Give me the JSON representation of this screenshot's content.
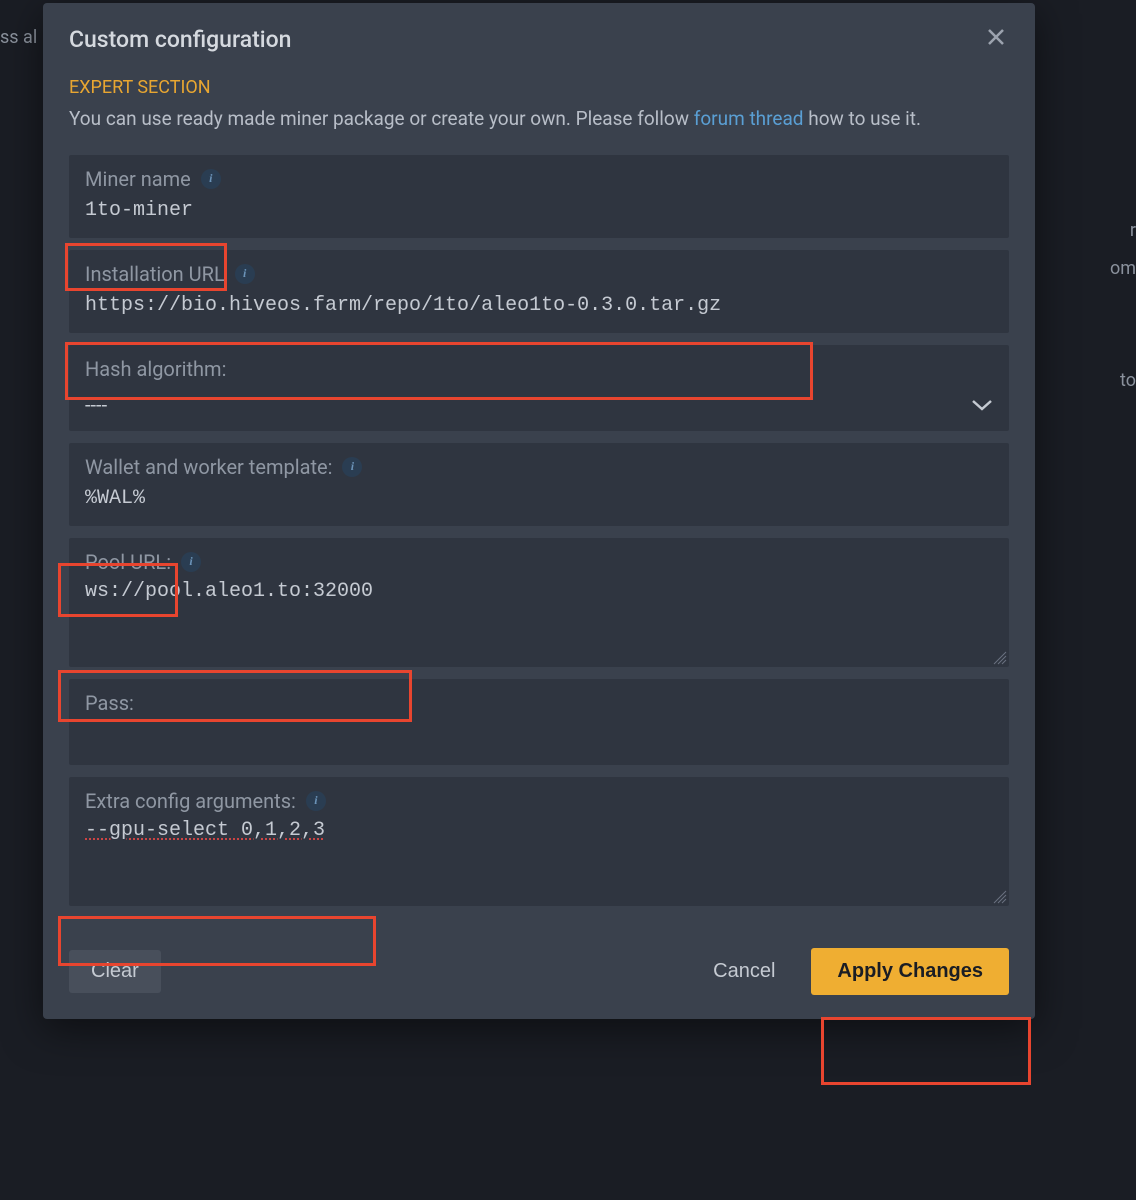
{
  "modal": {
    "title": "Custom configuration",
    "expert_label": "EXPERT SECTION",
    "expert_desc_1": "You can use ready made miner package or create your own. Please follow ",
    "forum_link_text": "forum thread",
    "expert_desc_2": " how to use it."
  },
  "fields": {
    "miner_name": {
      "label": "Miner name",
      "value": "1to-miner"
    },
    "install_url": {
      "label": "Installation URL",
      "value": "https://bio.hiveos.farm/repo/1to/aleo1to-0.3.0.tar.gz"
    },
    "hash_algo": {
      "label": "Hash algorithm:",
      "value": "----"
    },
    "wallet": {
      "label": "Wallet and worker template:",
      "value": "%WAL%"
    },
    "pool_url": {
      "label": "Pool URL:",
      "value": "ws://pool.aleo1.to:32000"
    },
    "pass": {
      "label": "Pass:",
      "value": ""
    },
    "extra": {
      "label": "Extra config arguments:",
      "value": "--gpu-select 0,1,2,3"
    }
  },
  "footer": {
    "clear": "Clear",
    "cancel": "Cancel",
    "apply": "Apply Changes"
  },
  "backdrop": {
    "t1": "ss al",
    "t2": "r",
    "t3": "om",
    "t4": "to"
  }
}
